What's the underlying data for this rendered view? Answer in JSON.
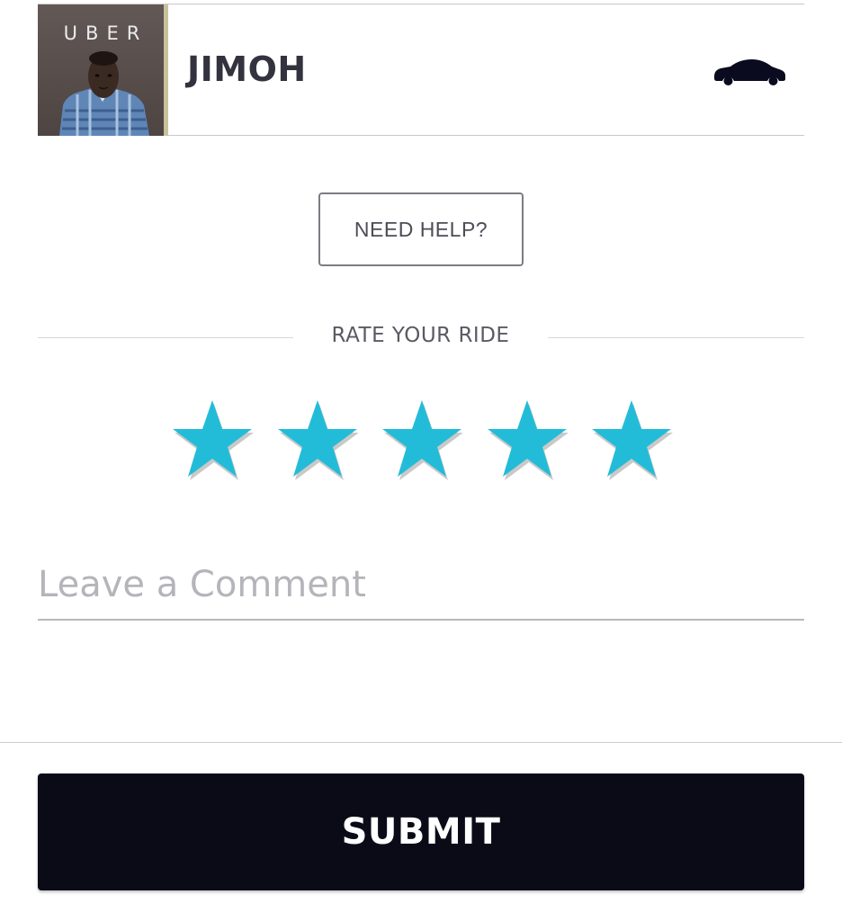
{
  "driver": {
    "name": "JIMOH",
    "photo_brand_text": "UBER",
    "vehicle_icon": "car-icon"
  },
  "help": {
    "label": "NEED HELP?"
  },
  "rating": {
    "heading": "RATE YOUR RIDE",
    "max_stars": 5,
    "selected_stars": 5,
    "star_icon": "star-icon",
    "star_color": "#23bcd8",
    "star_shadow_color": "#c9c9c9"
  },
  "comment": {
    "placeholder": "Leave a Comment",
    "value": ""
  },
  "submit": {
    "label": "SUBMIT"
  },
  "colors": {
    "submit_background": "#0b0b18",
    "text_dark": "#33333f",
    "placeholder": "#b4b4ba"
  }
}
